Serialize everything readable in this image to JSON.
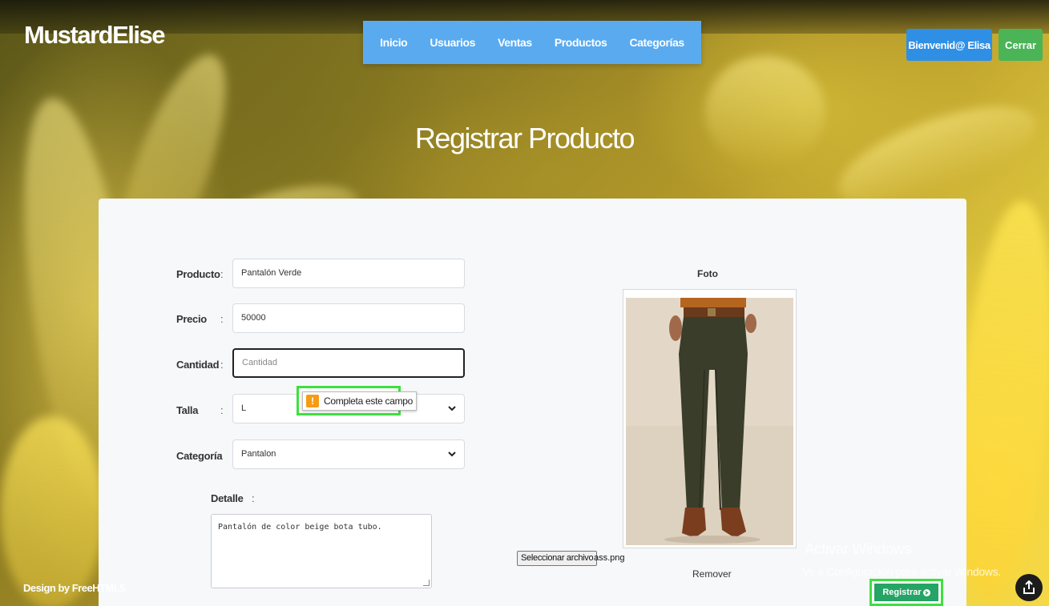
{
  "brand": "MustardElise",
  "nav": {
    "items": [
      "Inicio",
      "Usuarios",
      "Ventas",
      "Productos",
      "Categorías"
    ]
  },
  "header": {
    "welcome_label": "Bienvenid@ Elisa",
    "logout_label": "Cerrar"
  },
  "page_title": "Registrar Producto",
  "form": {
    "producto_label": "Producto",
    "producto_value": "Pantalón Verde",
    "precio_label": "Precio",
    "precio_value": "50000",
    "cantidad_label": "Cantidad",
    "cantidad_placeholder": "Cantidad",
    "talla_label": "Talla",
    "talla_value": "L",
    "categoria_label": "Categoría",
    "categoria_value": "Pantalon",
    "detalle_label": "Detalle",
    "detalle_value": "Pantalón de color beige bota tubo.",
    "colon": ":"
  },
  "validation_tooltip": "Completa este campo",
  "photo": {
    "label": "Foto",
    "file_button": "Seleccionar archivo",
    "file_name": "ass.png",
    "remove_label": "Remover"
  },
  "submit_label": "Registrar",
  "watermark": {
    "title": "Activar Windows",
    "subtitle": "Ve a Configuración para activar Windows."
  },
  "footer": "Design by FreeHTML5",
  "colors": {
    "nav_bg": "#5aaaf0",
    "welcome_bg": "#2f8fe4",
    "logout_bg": "#4bb457",
    "submit_bg": "#25a465",
    "highlight": "#3ee03e",
    "warning": "#f59b14"
  }
}
